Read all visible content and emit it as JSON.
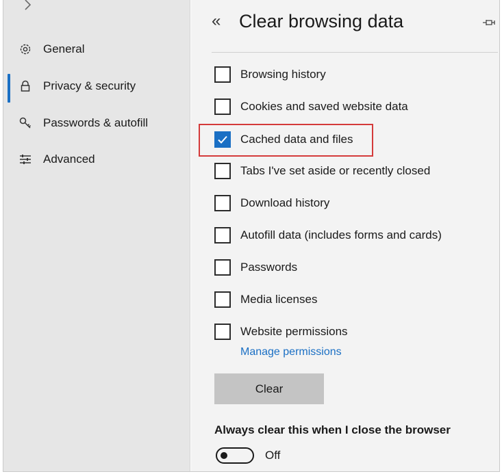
{
  "sidebar": {
    "items": [
      {
        "label": "General",
        "icon": "gear-icon"
      },
      {
        "label": "Privacy & security",
        "icon": "lock-icon",
        "active": true
      },
      {
        "label": "Passwords & autofill",
        "icon": "key-icon"
      },
      {
        "label": "Advanced",
        "icon": "sliders-icon"
      }
    ]
  },
  "panel": {
    "back": "«",
    "title": "Clear browsing data",
    "options": [
      {
        "label": "Browsing history",
        "checked": false
      },
      {
        "label": "Cookies and saved website data",
        "checked": false
      },
      {
        "label": "Cached data and files",
        "checked": true
      },
      {
        "label": "Tabs I've set aside or recently closed",
        "checked": false
      },
      {
        "label": "Download history",
        "checked": false
      },
      {
        "label": "Autofill data (includes forms and cards)",
        "checked": false
      },
      {
        "label": "Passwords",
        "checked": false
      },
      {
        "label": "Media licenses",
        "checked": false
      },
      {
        "label": "Website permissions",
        "checked": false
      }
    ],
    "manage_link": "Manage permissions",
    "clear_button": "Clear",
    "always_clear_label": "Always clear this when I close the browser",
    "toggle_state": "Off"
  },
  "colors": {
    "accent": "#1a6fc4",
    "highlight": "#d43a3a",
    "sidebar_bg": "#e6e6e6",
    "panel_bg": "#f3f3f3",
    "button_bg": "#c4c4c4"
  }
}
